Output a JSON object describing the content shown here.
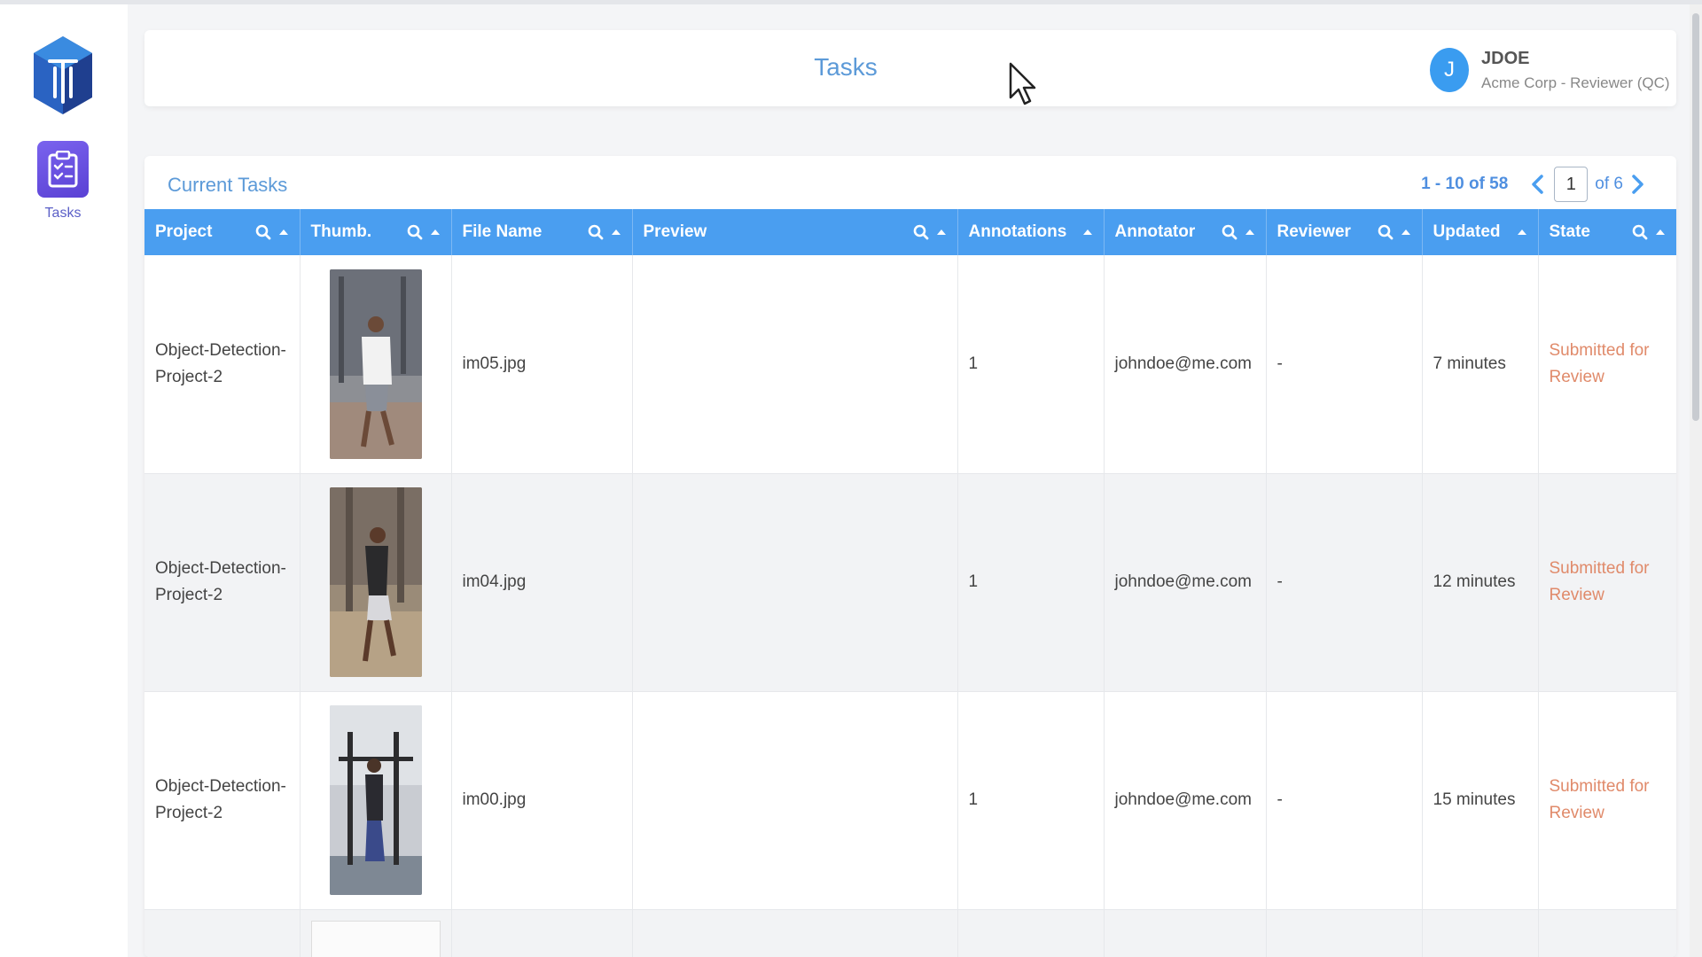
{
  "sidebar": {
    "nav": [
      {
        "label": "Tasks",
        "icon": "clipboard-check-icon",
        "active": true
      }
    ]
  },
  "header": {
    "title": "Tasks",
    "user": {
      "avatar_letter": "J",
      "name": "JDOE",
      "org_role": "Acme Corp - Reviewer (QC)"
    }
  },
  "tasks": {
    "title": "Current Tasks",
    "pager": {
      "range": "1 - 10 of 58",
      "current_page": "1",
      "of_label": "of 6"
    },
    "columns": [
      {
        "label": "Project",
        "search": true,
        "sort": true
      },
      {
        "label": "Thumb.",
        "search": true,
        "sort": true
      },
      {
        "label": "File Name",
        "search": true,
        "sort": true
      },
      {
        "label": "Preview",
        "search": true,
        "sort": true
      },
      {
        "label": "Annotations",
        "search": false,
        "sort": true
      },
      {
        "label": "Annotator",
        "search": true,
        "sort": true
      },
      {
        "label": "Reviewer",
        "search": true,
        "sort": true
      },
      {
        "label": "Updated",
        "search": false,
        "sort": true
      },
      {
        "label": "State",
        "search": true,
        "sort": true
      }
    ],
    "rows": [
      {
        "project": "Object-Detection-Project-2",
        "file_name": "im05.jpg",
        "preview": "",
        "annotations": "1",
        "annotator": "johndoe@me.com",
        "reviewer": "-",
        "updated": "7 minutes",
        "state": "Submitted for Review"
      },
      {
        "project": "Object-Detection-Project-2",
        "file_name": "im04.jpg",
        "preview": "",
        "annotations": "1",
        "annotator": "johndoe@me.com",
        "reviewer": "-",
        "updated": "12 minutes",
        "state": "Submitted for Review"
      },
      {
        "project": "Object-Detection-Project-2",
        "file_name": "im00.jpg",
        "preview": "",
        "annotations": "1",
        "annotator": "johndoe@me.com",
        "reviewer": "-",
        "updated": "15 minutes",
        "state": "Submitted for Review"
      }
    ]
  },
  "colors": {
    "accent": "#4a9ef0",
    "title": "#5c9ad8",
    "state": "#e08a6a",
    "nav": "#6a52e4"
  }
}
